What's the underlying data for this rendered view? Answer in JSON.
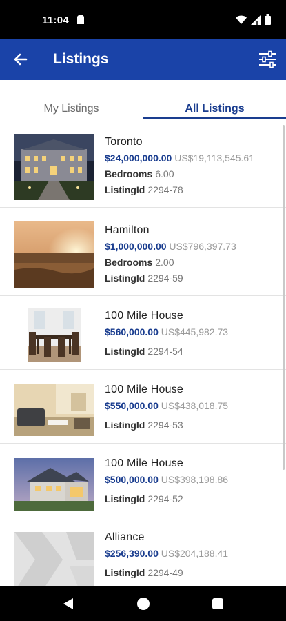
{
  "status_bar": {
    "time": "11:04",
    "icons": [
      "sim-card-icon",
      "wifi-icon",
      "signal-icon",
      "battery-icon"
    ]
  },
  "app_bar": {
    "title": "Listings",
    "back_icon": "arrow-left-icon",
    "filter_icon": "sliders-icon",
    "color": "#1a43a8"
  },
  "tabs": [
    {
      "label": "My Listings",
      "selected": false
    },
    {
      "label": "All Listings",
      "selected": true
    }
  ],
  "listings": [
    {
      "city": "Toronto",
      "price": "$24,000,000.00",
      "usd": "US$19,113,545.61",
      "bedrooms_label": "Bedrooms",
      "bedrooms": "6.00",
      "id_label": "ListingId",
      "id": "2294-78",
      "image": "mansion-night-photo"
    },
    {
      "city": "Hamilton",
      "price": "$1,000,000.00",
      "usd": "US$796,397.73",
      "bedrooms_label": "Bedrooms",
      "bedrooms": "2.00",
      "id_label": "ListingId",
      "id": "2294-59",
      "image": "sunset-field-photo"
    },
    {
      "city": "100 Mile House",
      "price": "$560,000.00",
      "usd": "US$445,982.73",
      "id_label": "ListingId",
      "id": "2294-54",
      "image": "dining-room-photo"
    },
    {
      "city": "100 Mile House",
      "price": "$550,000.00",
      "usd": "US$438,018.75",
      "id_label": "ListingId",
      "id": "2294-53",
      "image": "living-room-photo"
    },
    {
      "city": "100 Mile House",
      "price": "$500,000.00",
      "usd": "US$398,198.86",
      "id_label": "ListingId",
      "id": "2294-52",
      "image": "house-dusk-photo"
    },
    {
      "city": "Alliance",
      "price": "$256,390.00",
      "usd": "US$204,188.41",
      "id_label": "ListingId",
      "id": "2294-49",
      "image": "placeholder-logo-image"
    }
  ],
  "nav_bar": {
    "icons": [
      "back-triangle-icon",
      "home-circle-icon",
      "recents-square-icon"
    ]
  },
  "colors": {
    "accent": "#1a3d8f",
    "app_bar": "#1a43a8",
    "muted": "#9a9a9a"
  }
}
